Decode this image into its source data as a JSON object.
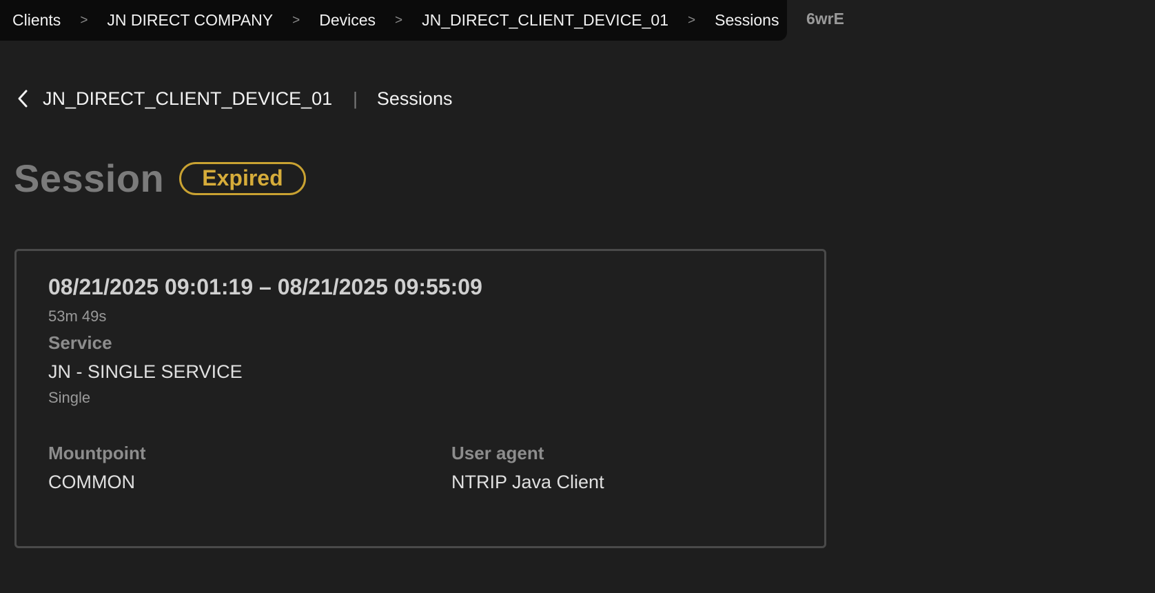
{
  "breadcrumb": {
    "items": [
      {
        "label": "Clients"
      },
      {
        "label": "JN DIRECT COMPANY"
      },
      {
        "label": "Devices"
      },
      {
        "label": "JN_DIRECT_CLIENT_DEVICE_01"
      },
      {
        "label": "Sessions"
      }
    ],
    "separator": ">",
    "current": "6wrE"
  },
  "subheader": {
    "back_icon": "chevron-left-icon",
    "device": "JN_DIRECT_CLIENT_DEVICE_01",
    "divider": "|",
    "page": "Sessions"
  },
  "title": {
    "text": "Session",
    "status": "Expired",
    "status_color": "#d6ac3a"
  },
  "session": {
    "range": "08/21/2025 09:01:19 – 08/21/2025 09:55:09",
    "duration": "53m 49s",
    "service_label": "Service",
    "service_name": "JN - SINGLE SERVICE",
    "service_type": "Single",
    "mountpoint_label": "Mountpoint",
    "mountpoint_value": "COMMON",
    "user_agent_label": "User agent",
    "user_agent_value": "NTRIP Java Client"
  }
}
